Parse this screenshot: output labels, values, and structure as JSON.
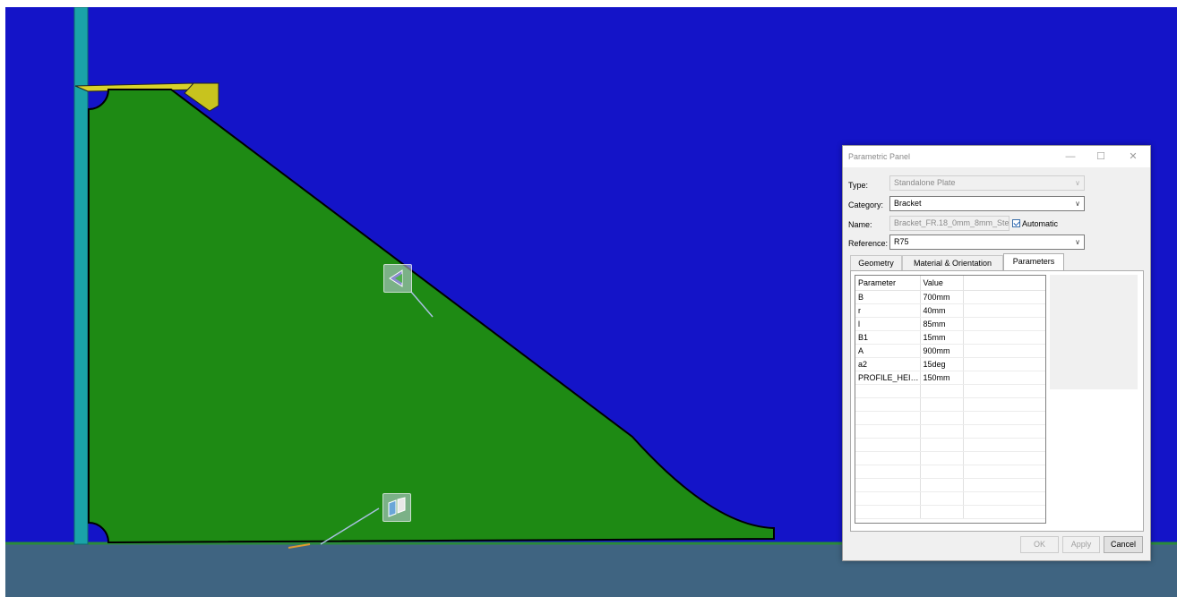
{
  "panel": {
    "title": "Parametric Panel",
    "window_controls": {
      "minimize": "—",
      "maximize": "☐",
      "close": "✕"
    },
    "type": {
      "label": "Type:",
      "value": "Standalone Plate"
    },
    "category": {
      "label": "Category:",
      "value": "Bracket"
    },
    "name": {
      "label": "Name:",
      "value": "Bracket_FR.18_0mm_8mm_Stee",
      "automatic_label": "Automatic",
      "automatic_checked": true
    },
    "reference": {
      "label": "Reference:",
      "value": "R75"
    },
    "tabs": [
      {
        "label": "Geometry",
        "active": false
      },
      {
        "label": "Material & Orientation",
        "active": false
      },
      {
        "label": "Parameters",
        "active": true
      }
    ],
    "table": {
      "headers": [
        "Parameter",
        "Value"
      ],
      "rows": [
        [
          "B",
          "700mm"
        ],
        [
          "r",
          "40mm"
        ],
        [
          "l",
          "85mm"
        ],
        [
          "B1",
          "15mm"
        ],
        [
          "A",
          "900mm"
        ],
        [
          "a2",
          "15deg"
        ],
        [
          "PROFILE_HEIG...",
          "150mm"
        ]
      ]
    },
    "buttons": {
      "ok": "OK",
      "apply": "Apply",
      "cancel": "Cancel"
    }
  },
  "scene": {
    "background_color": "#1414c8",
    "plate_color": "#1e8a14",
    "floor_color": "#3f6481",
    "profile_color": "#1aa3a8",
    "flange_color": "#c8c31e",
    "gizmos": [
      "rotate-manipulator-icon",
      "normal-manipulator-icon"
    ]
  }
}
